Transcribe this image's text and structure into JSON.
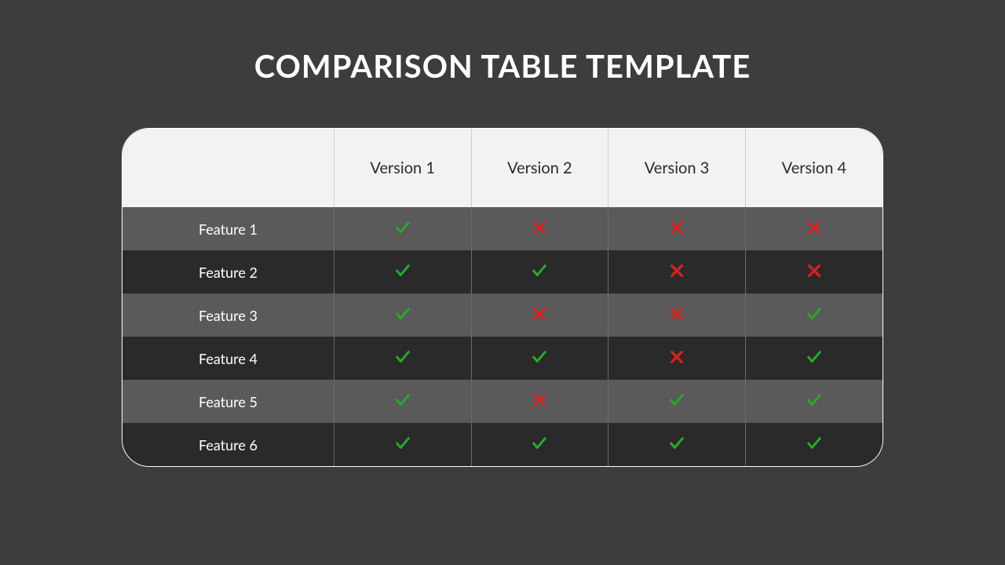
{
  "title": "COMPARISON TABLE TEMPLATE",
  "columns": [
    "Version 1",
    "Version 2",
    "Version 3",
    "Version 4"
  ],
  "rows": [
    {
      "label": "Feature 1",
      "values": [
        "check",
        "cross",
        "cross",
        "cross"
      ]
    },
    {
      "label": "Feature 2",
      "values": [
        "check",
        "check",
        "cross",
        "cross"
      ]
    },
    {
      "label": "Feature 3",
      "values": [
        "check",
        "cross",
        "cross",
        "check"
      ]
    },
    {
      "label": "Feature 4",
      "values": [
        "check",
        "check",
        "cross",
        "check"
      ]
    },
    {
      "label": "Feature 5",
      "values": [
        "check",
        "cross",
        "check",
        "check"
      ]
    },
    {
      "label": "Feature 6",
      "values": [
        "check",
        "check",
        "check",
        "check"
      ]
    }
  ],
  "colors": {
    "check": "#2aa82a",
    "cross": "#d92020"
  }
}
